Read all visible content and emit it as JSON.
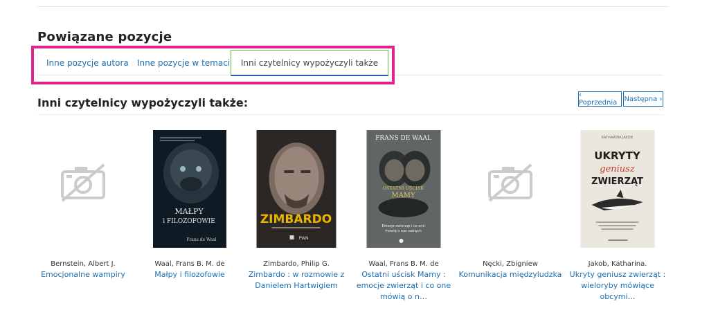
{
  "section": {
    "title": "Powiązane pozycje"
  },
  "tabs": [
    {
      "label": "Inne pozycje autora"
    },
    {
      "label": "Inne pozycje w temacie"
    },
    {
      "label": "Inni czytelnicy wypożyczyli także"
    }
  ],
  "results": {
    "title": "Inni czytelnicy wypożyczyli także:"
  },
  "pager": {
    "prev": "‹ Poprzednia",
    "next": "Następna ›"
  },
  "items": [
    {
      "author": "Bernstein, Albert J.",
      "title": "Emocjonalne wampiry",
      "cover": "camera-placeholder-icon"
    },
    {
      "author": "Waal, Frans B. M. de",
      "title": "Małpy i filozofowie",
      "cover": "book-cover",
      "cover_text": {
        "title": "MAŁPY i FILOZOFOWIE",
        "author": "Frans de Waal"
      }
    },
    {
      "author": "Zimbardo, Philip G.",
      "title": "Zimbardo : w rozmowie z Danielem Hartwigiem",
      "cover": "book-cover",
      "cover_text": {
        "title": "ZIMBARDO",
        "publisher": "PWN"
      }
    },
    {
      "author": "Waal, Frans B. M. de",
      "title": "Ostatni uścisk Mamy : emocje zwierząt i co one mówią o n…",
      "cover": "book-cover",
      "cover_text": {
        "author": "FRANS DE WAAL",
        "title": "OSTATNI UŚCISK MAMY",
        "subtitle": "Emocje zwierząt i co one mówią o nas samych"
      }
    },
    {
      "author": "Nęcki, Zbigniew",
      "title": "Komunikacja międzyludzka",
      "cover": "camera-placeholder-icon"
    },
    {
      "author": "Jakob, Katharina.",
      "title": "Ukryty geniusz zwierząt : wieloryby mówiące obcymi…",
      "cover": "book-cover",
      "cover_text": {
        "author": "KATHARINA JAKOB",
        "title_1": "UKRYTY",
        "title_2": "geniusz",
        "title_3": "ZWIERZĄT"
      }
    }
  ],
  "colors": {
    "highlight": "#e0228f",
    "link": "#1f6fb0",
    "active_tab_border": "#6bb64a"
  }
}
